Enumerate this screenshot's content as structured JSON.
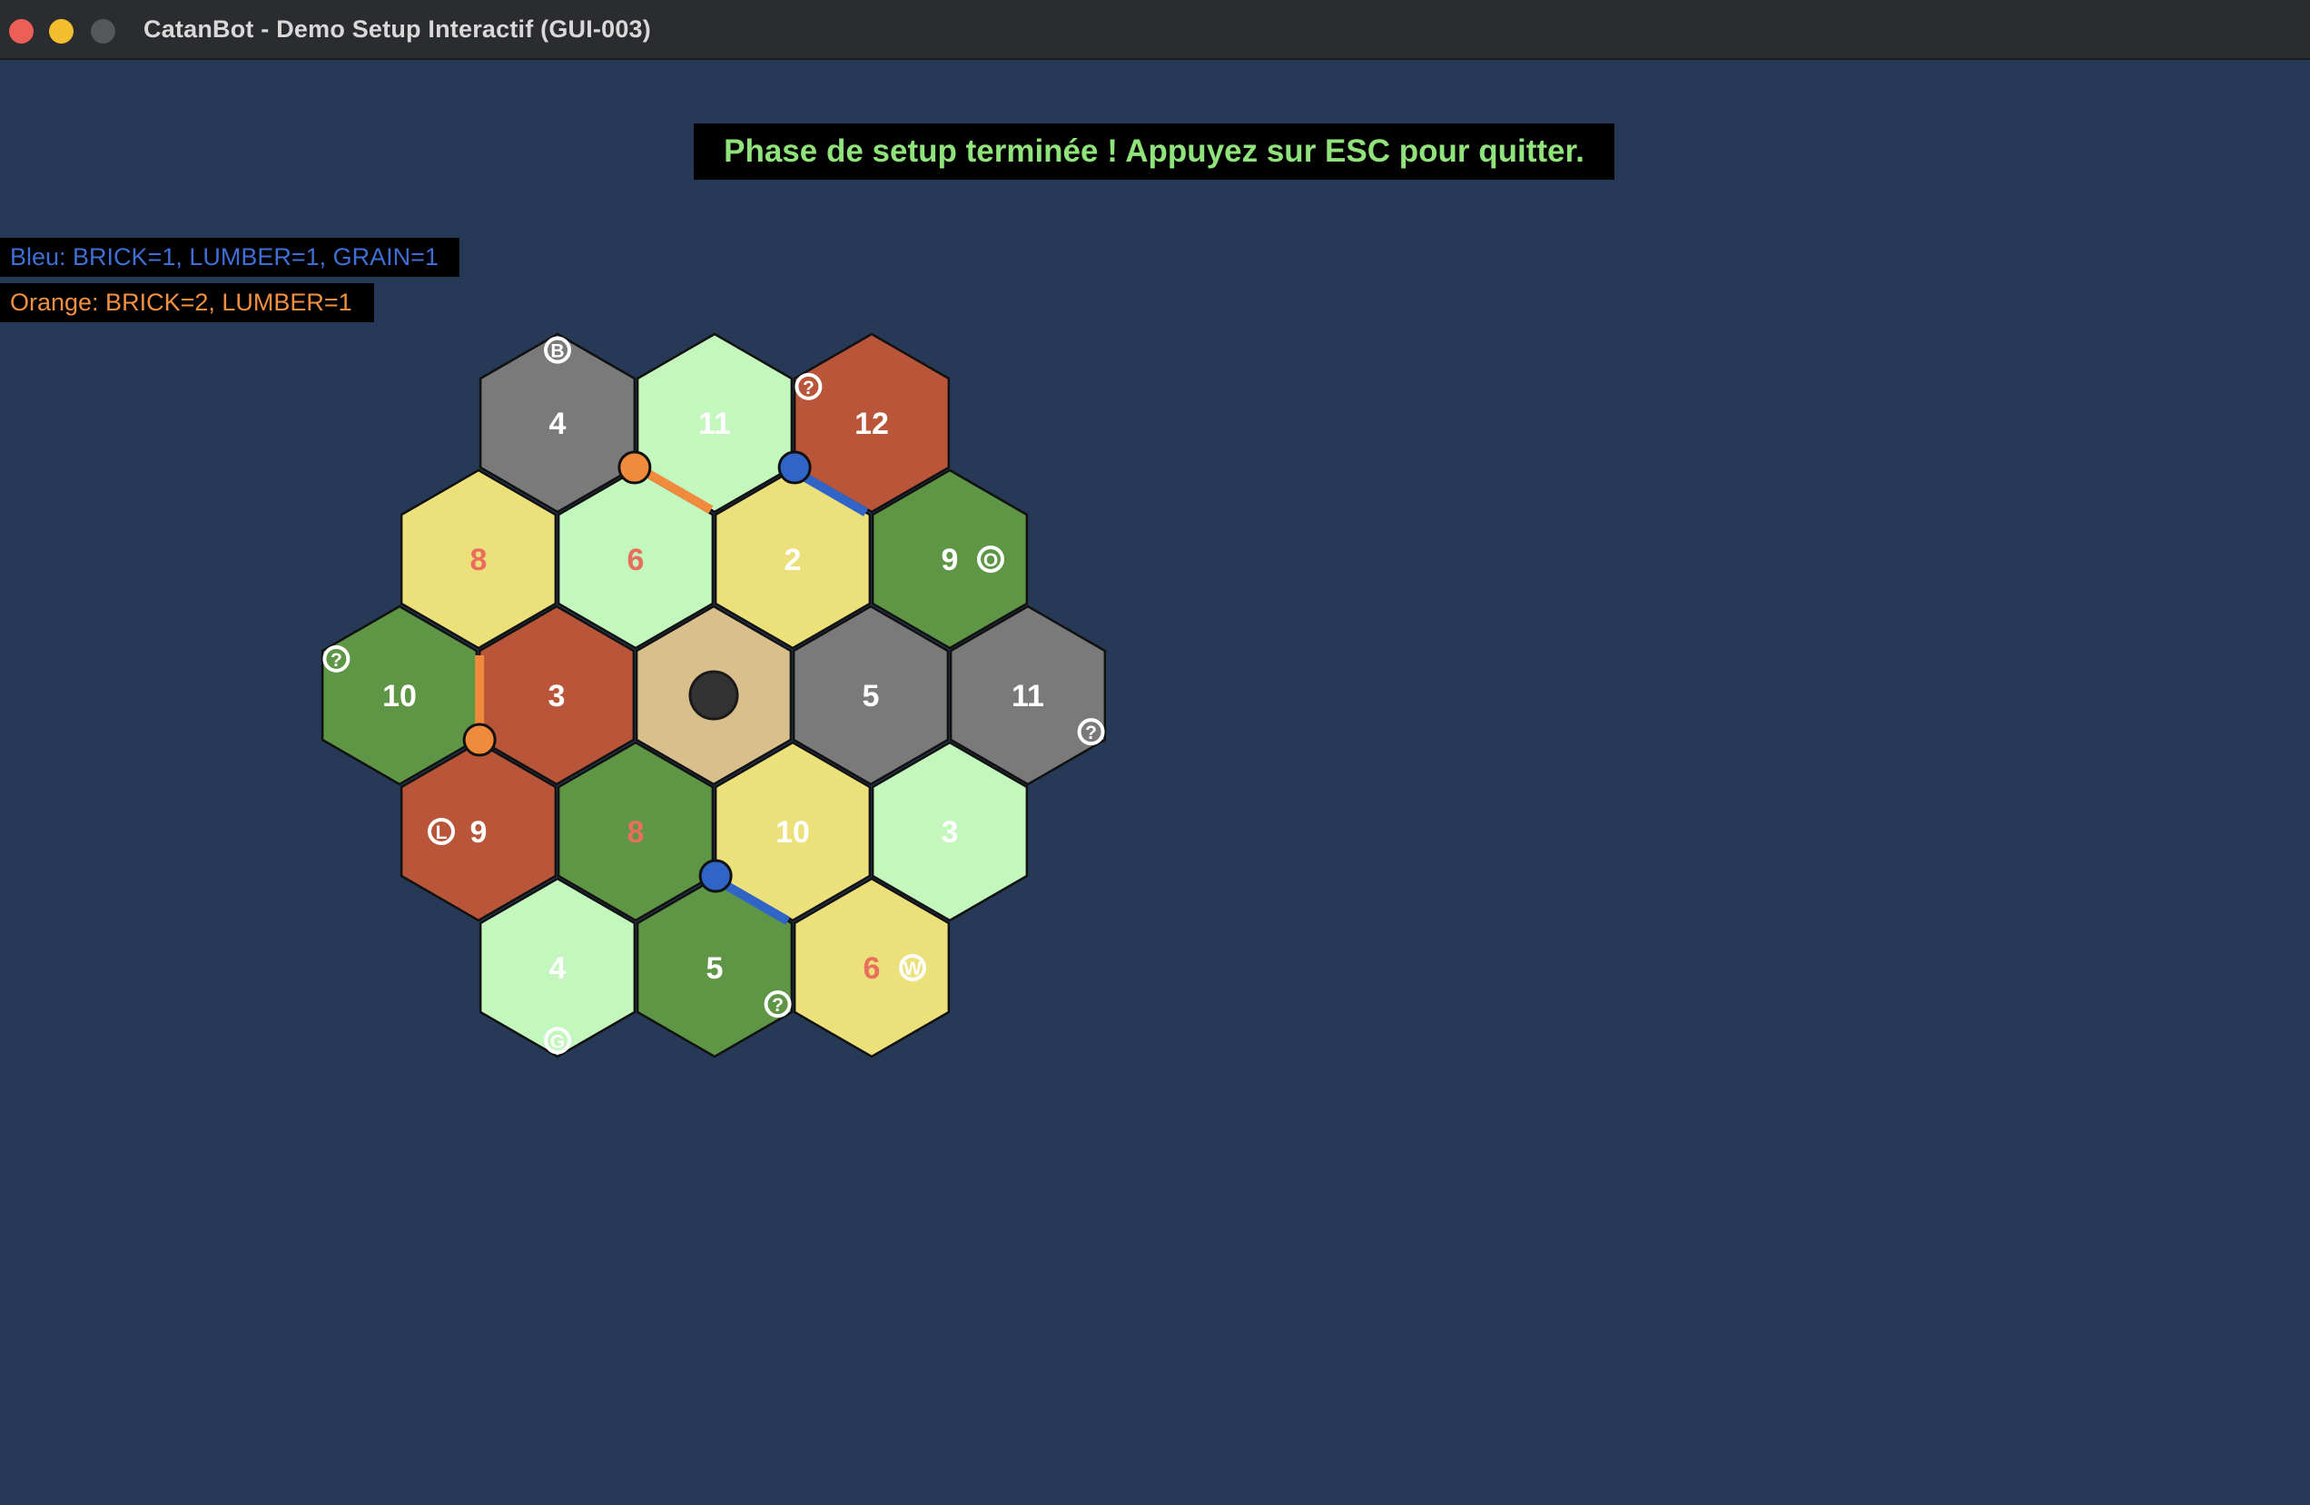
{
  "window": {
    "title": "CatanBot - Demo Setup Interactif (GUI-003)"
  },
  "banner": {
    "text": "Phase de setup terminée ! Appuyez sur ESC pour quitter."
  },
  "resources": {
    "blue": "Bleu: BRICK=1, LUMBER=1, GRAIN=1",
    "orange": "Orange: BRICK=2, LUMBER=1"
  },
  "colors": {
    "ore": "#7a7a7a",
    "pasture": "#c3f7bd",
    "brick": "#b95538",
    "grain": "#ece07a",
    "forest": "#5e9645",
    "desert": "#d9bf8c",
    "blue_player": "#3064c6",
    "orange_player": "#f08a3c",
    "hot_number": "#e86e5e",
    "robber": "#333333"
  },
  "board": {
    "tiles": [
      {
        "row": 0,
        "col": 0,
        "terrain": "ore",
        "number": "4"
      },
      {
        "row": 0,
        "col": 1,
        "terrain": "pasture",
        "number": "11"
      },
      {
        "row": 0,
        "col": 2,
        "terrain": "brick",
        "number": "12"
      },
      {
        "row": 1,
        "col": 0,
        "terrain": "grain",
        "number": "8",
        "hot": true
      },
      {
        "row": 1,
        "col": 1,
        "terrain": "pasture",
        "number": "6",
        "hot": true
      },
      {
        "row": 1,
        "col": 2,
        "terrain": "grain",
        "number": "2"
      },
      {
        "row": 1,
        "col": 3,
        "terrain": "forest",
        "number": "9"
      },
      {
        "row": 2,
        "col": 0,
        "terrain": "forest",
        "number": "10"
      },
      {
        "row": 2,
        "col": 1,
        "terrain": "brick",
        "number": "3"
      },
      {
        "row": 2,
        "col": 2,
        "terrain": "desert",
        "number": "",
        "robber": true
      },
      {
        "row": 2,
        "col": 3,
        "terrain": "ore",
        "number": "5"
      },
      {
        "row": 2,
        "col": 4,
        "terrain": "ore",
        "number": "11"
      },
      {
        "row": 3,
        "col": 0,
        "terrain": "brick",
        "number": "9"
      },
      {
        "row": 3,
        "col": 1,
        "terrain": "forest",
        "number": "8",
        "hot": true
      },
      {
        "row": 3,
        "col": 2,
        "terrain": "grain",
        "number": "10"
      },
      {
        "row": 3,
        "col": 3,
        "terrain": "pasture",
        "number": "3"
      },
      {
        "row": 4,
        "col": 0,
        "terrain": "pasture",
        "number": "4"
      },
      {
        "row": 4,
        "col": 1,
        "terrain": "forest",
        "number": "5"
      },
      {
        "row": 4,
        "col": 2,
        "terrain": "grain",
        "number": "6",
        "hot": true
      }
    ],
    "ports": [
      {
        "row": 0,
        "col": 0,
        "corner": 0,
        "glyph": "B"
      },
      {
        "row": 0,
        "col": 2,
        "corner": 5,
        "glyph": "?"
      },
      {
        "row": 1,
        "col": 3,
        "corner": "center-right",
        "glyph": "O"
      },
      {
        "row": 2,
        "col": 0,
        "corner": 5,
        "glyph": "?"
      },
      {
        "row": 2,
        "col": 4,
        "corner": 2,
        "glyph": "?"
      },
      {
        "row": 3,
        "col": 0,
        "corner": "center-left",
        "glyph": "L"
      },
      {
        "row": 4,
        "col": 2,
        "corner": "center-right",
        "glyph": "W"
      },
      {
        "row": 4,
        "col": 0,
        "corner": 3,
        "glyph": "G"
      },
      {
        "row": 4,
        "col": 1,
        "corner": 2,
        "glyph": "?"
      }
    ],
    "settlements": [
      {
        "player": "orange",
        "row": 0,
        "col": 0,
        "corner": 2
      },
      {
        "player": "orange",
        "row": 2,
        "col": 1,
        "corner": 4
      },
      {
        "player": "blue",
        "row": 0,
        "col": 2,
        "corner": 4
      },
      {
        "player": "blue",
        "row": 3,
        "col": 2,
        "corner": 4
      }
    ],
    "roads": [
      {
        "player": "orange",
        "row": 0,
        "col": 1,
        "edge": 3
      },
      {
        "player": "orange",
        "row": 2,
        "col": 1,
        "edge": 4
      },
      {
        "player": "blue",
        "row": 1,
        "col": 2,
        "edge": 0
      },
      {
        "player": "blue",
        "row": 4,
        "col": 1,
        "edge": 0
      }
    ]
  }
}
